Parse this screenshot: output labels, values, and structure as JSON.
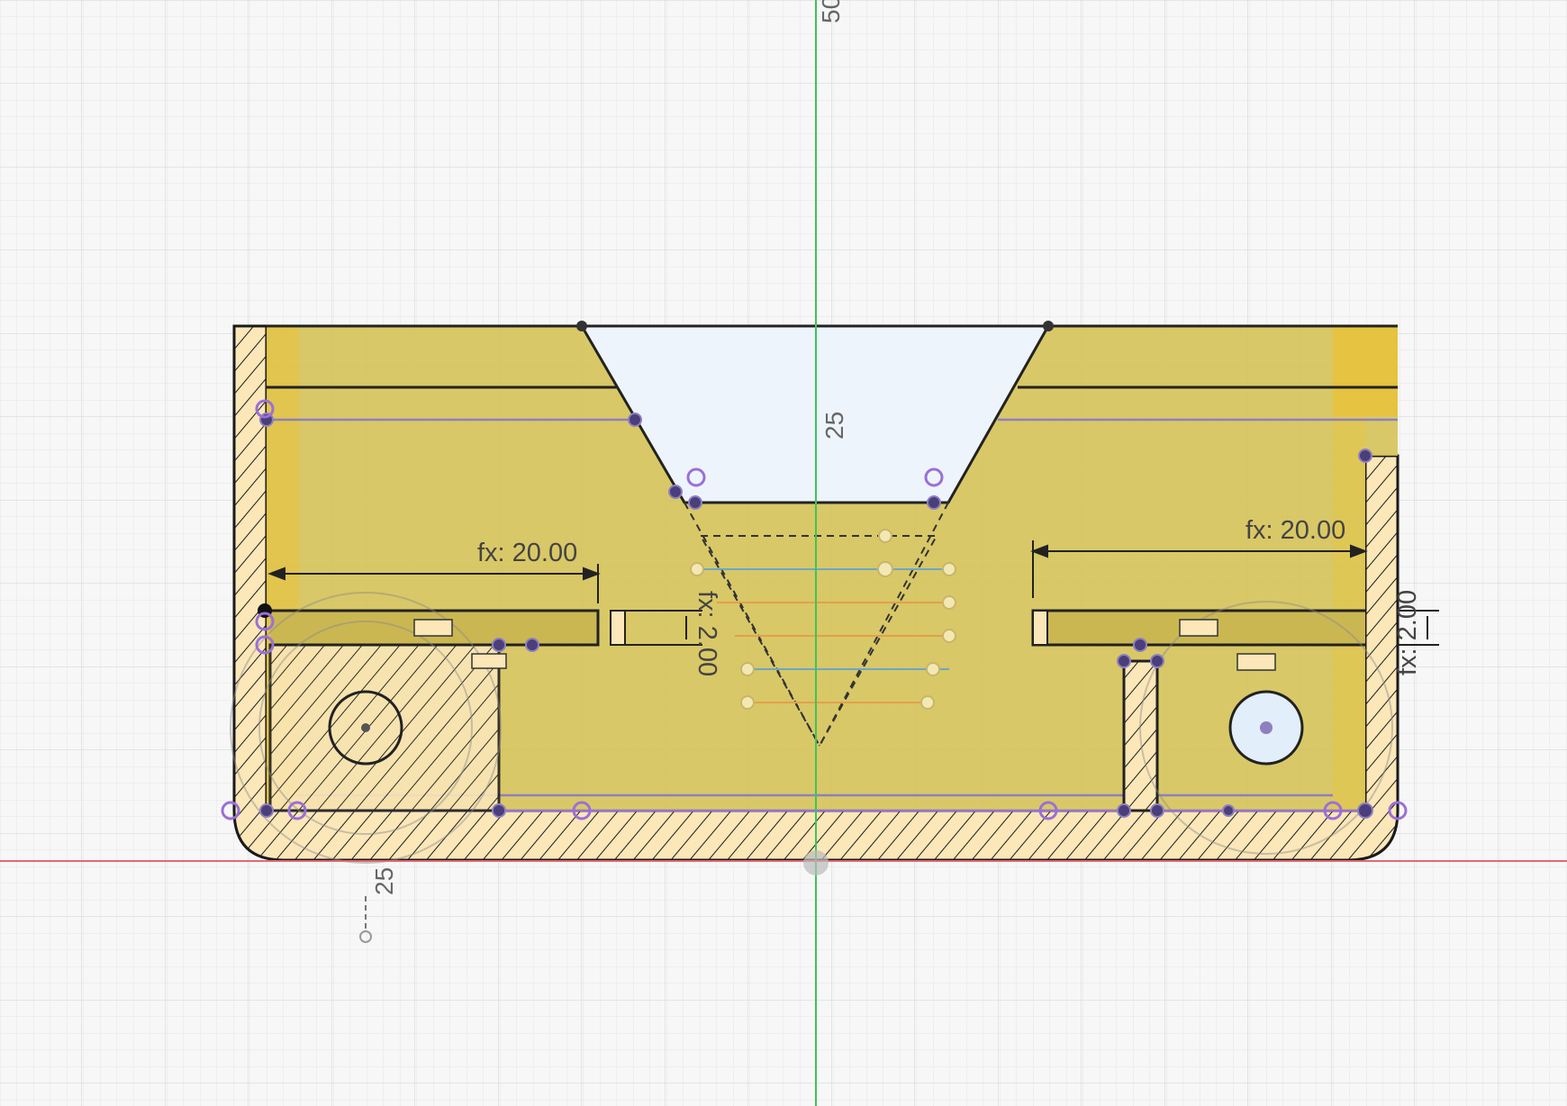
{
  "app": {
    "view": "sketch-canvas"
  },
  "colors": {
    "background": "#f7f7f7",
    "grid_minor": "#e4e6e8",
    "grid_major": "#cfd3d6",
    "x_axis": "#e06a70",
    "y_axis": "#3ec35a",
    "profile_fill": "#d6c35a",
    "hatch_fill": "#fbe7b8",
    "sketch_line": "#222222",
    "constraint_point": "#9a70d8",
    "glass_fill": "#eef4fb"
  },
  "axis_labels": {
    "top": "50",
    "center": "25",
    "bottom_left": "25"
  },
  "dimensions": {
    "left_width": "fx: 20.00",
    "right_width": "fx: 20.00",
    "left_thickness": "fx: 2.00",
    "right_thickness": "fx: 2.00"
  }
}
